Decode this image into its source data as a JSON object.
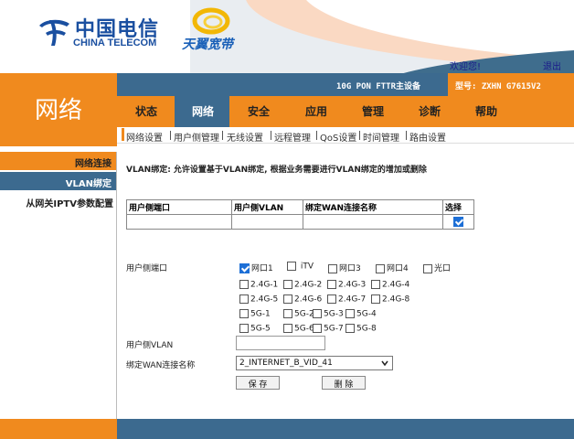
{
  "brand": {
    "china_telecom_cn": "中国电信",
    "china_telecom_en": "CHINA TELECOM",
    "tianyi": "天翼宽带"
  },
  "header": {
    "welcome": "欢迎您!",
    "logout": "退出",
    "device": "10G PON FTTR主设备",
    "model": "型号: ZXHN G7615V2"
  },
  "left": {
    "section_title": "网络"
  },
  "nav": {
    "tabs": [
      "状态",
      "网络",
      "安全",
      "应用",
      "管理",
      "诊断",
      "帮助"
    ],
    "active_index": 1
  },
  "subnav": {
    "items": [
      "网络设置",
      "用户侧管理",
      "无线设置",
      "远程管理",
      "QoS设置",
      "时间管理",
      "路由设置"
    ],
    "active_index": 0
  },
  "side": {
    "items": [
      "网络连接",
      "VLAN绑定",
      "从网关IPTV参数配置"
    ]
  },
  "content": {
    "note": "VLAN绑定: 允许设置基于VLAN绑定, 根据业务需要进行VLAN绑定的增加或删除",
    "table": {
      "headers": [
        "用户侧端口",
        "用户侧VLAN",
        "绑定WAN连接名称",
        "选择"
      ],
      "rows": [
        [
          "",
          "",
          "",
          "checked"
        ]
      ]
    },
    "form": {
      "port_label": "用户侧端口",
      "ports": [
        {
          "label": "网口1",
          "checked": true
        },
        {
          "label": "iTV",
          "checked": false
        },
        {
          "label": "网口3",
          "checked": false
        },
        {
          "label": "网口4",
          "checked": false
        },
        {
          "label": "光口",
          "checked": false
        }
      ],
      "ssids_24": [
        "2.4G-1",
        "2.4G-2",
        "2.4G-3",
        "2.4G-4",
        "2.4G-5",
        "2.4G-6",
        "2.4G-7",
        "2.4G-8"
      ],
      "ssids_5": [
        "5G-1",
        "5G-2",
        "5G-3",
        "5G-4",
        "5G-5",
        "5G-6",
        "5G-7",
        "5G-8"
      ],
      "vlan_label": "用户侧VLAN",
      "vlan_value": "",
      "wan_label": "绑定WAN连接名称",
      "wan_value": "2_INTERNET_B_VID_41",
      "save": "保 存",
      "delete": "删 除"
    }
  },
  "colors": {
    "orange": "#f08a1e",
    "blue": "#3c6a8f",
    "check": "#1d6fd6"
  }
}
